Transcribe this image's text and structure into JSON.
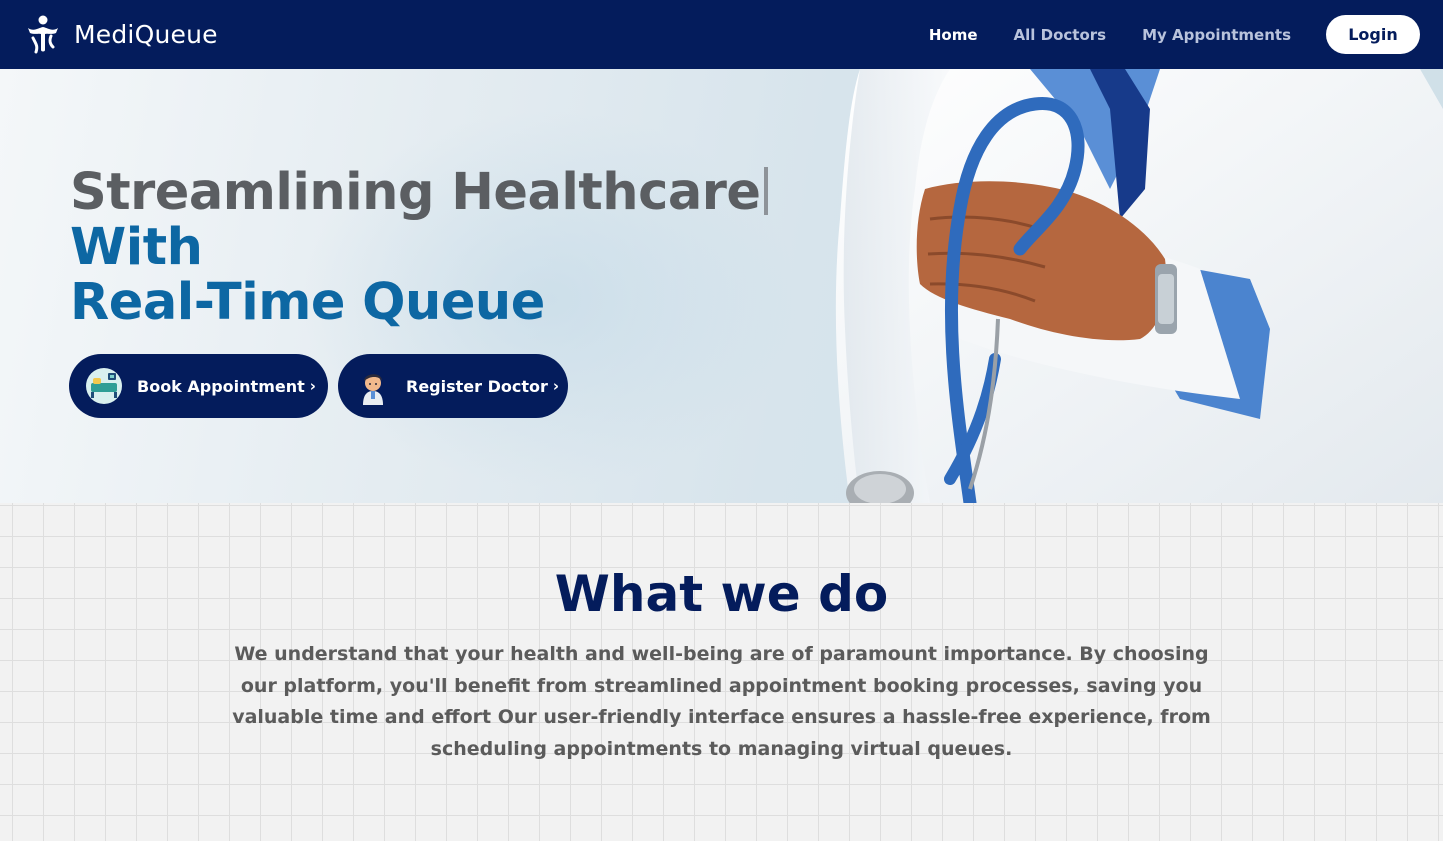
{
  "brand": {
    "name": "MediQueue",
    "logo_icon": "medical-person-icon"
  },
  "nav": {
    "links": [
      {
        "label": "Home",
        "active": true
      },
      {
        "label": "All Doctors",
        "active": false
      },
      {
        "label": "My Appointments",
        "active": false
      }
    ],
    "login_label": "Login"
  },
  "hero": {
    "title_line1": "Streamlining Healthcare",
    "title_line2": "With",
    "title_line3": "Real-Time Queue",
    "book_label": "Book Appointment",
    "register_label": "Register Doctor",
    "book_icon": "hospital-bed-icon",
    "register_icon": "doctor-avatar-icon",
    "chevron": "›"
  },
  "about": {
    "title": "What we do",
    "text": "We understand that your health and well-being are of paramount importance. By choosing our platform, you'll benefit from streamlined appointment booking processes, saving you valuable time and effort Our user-friendly interface ensures a hassle-free experience, from scheduling appointments to managing virtual queues."
  },
  "colors": {
    "navy": "#041c5c",
    "blue_heading": "#0d67a3",
    "gray_heading": "#5b5e62",
    "body_text": "#5b5b5b"
  }
}
